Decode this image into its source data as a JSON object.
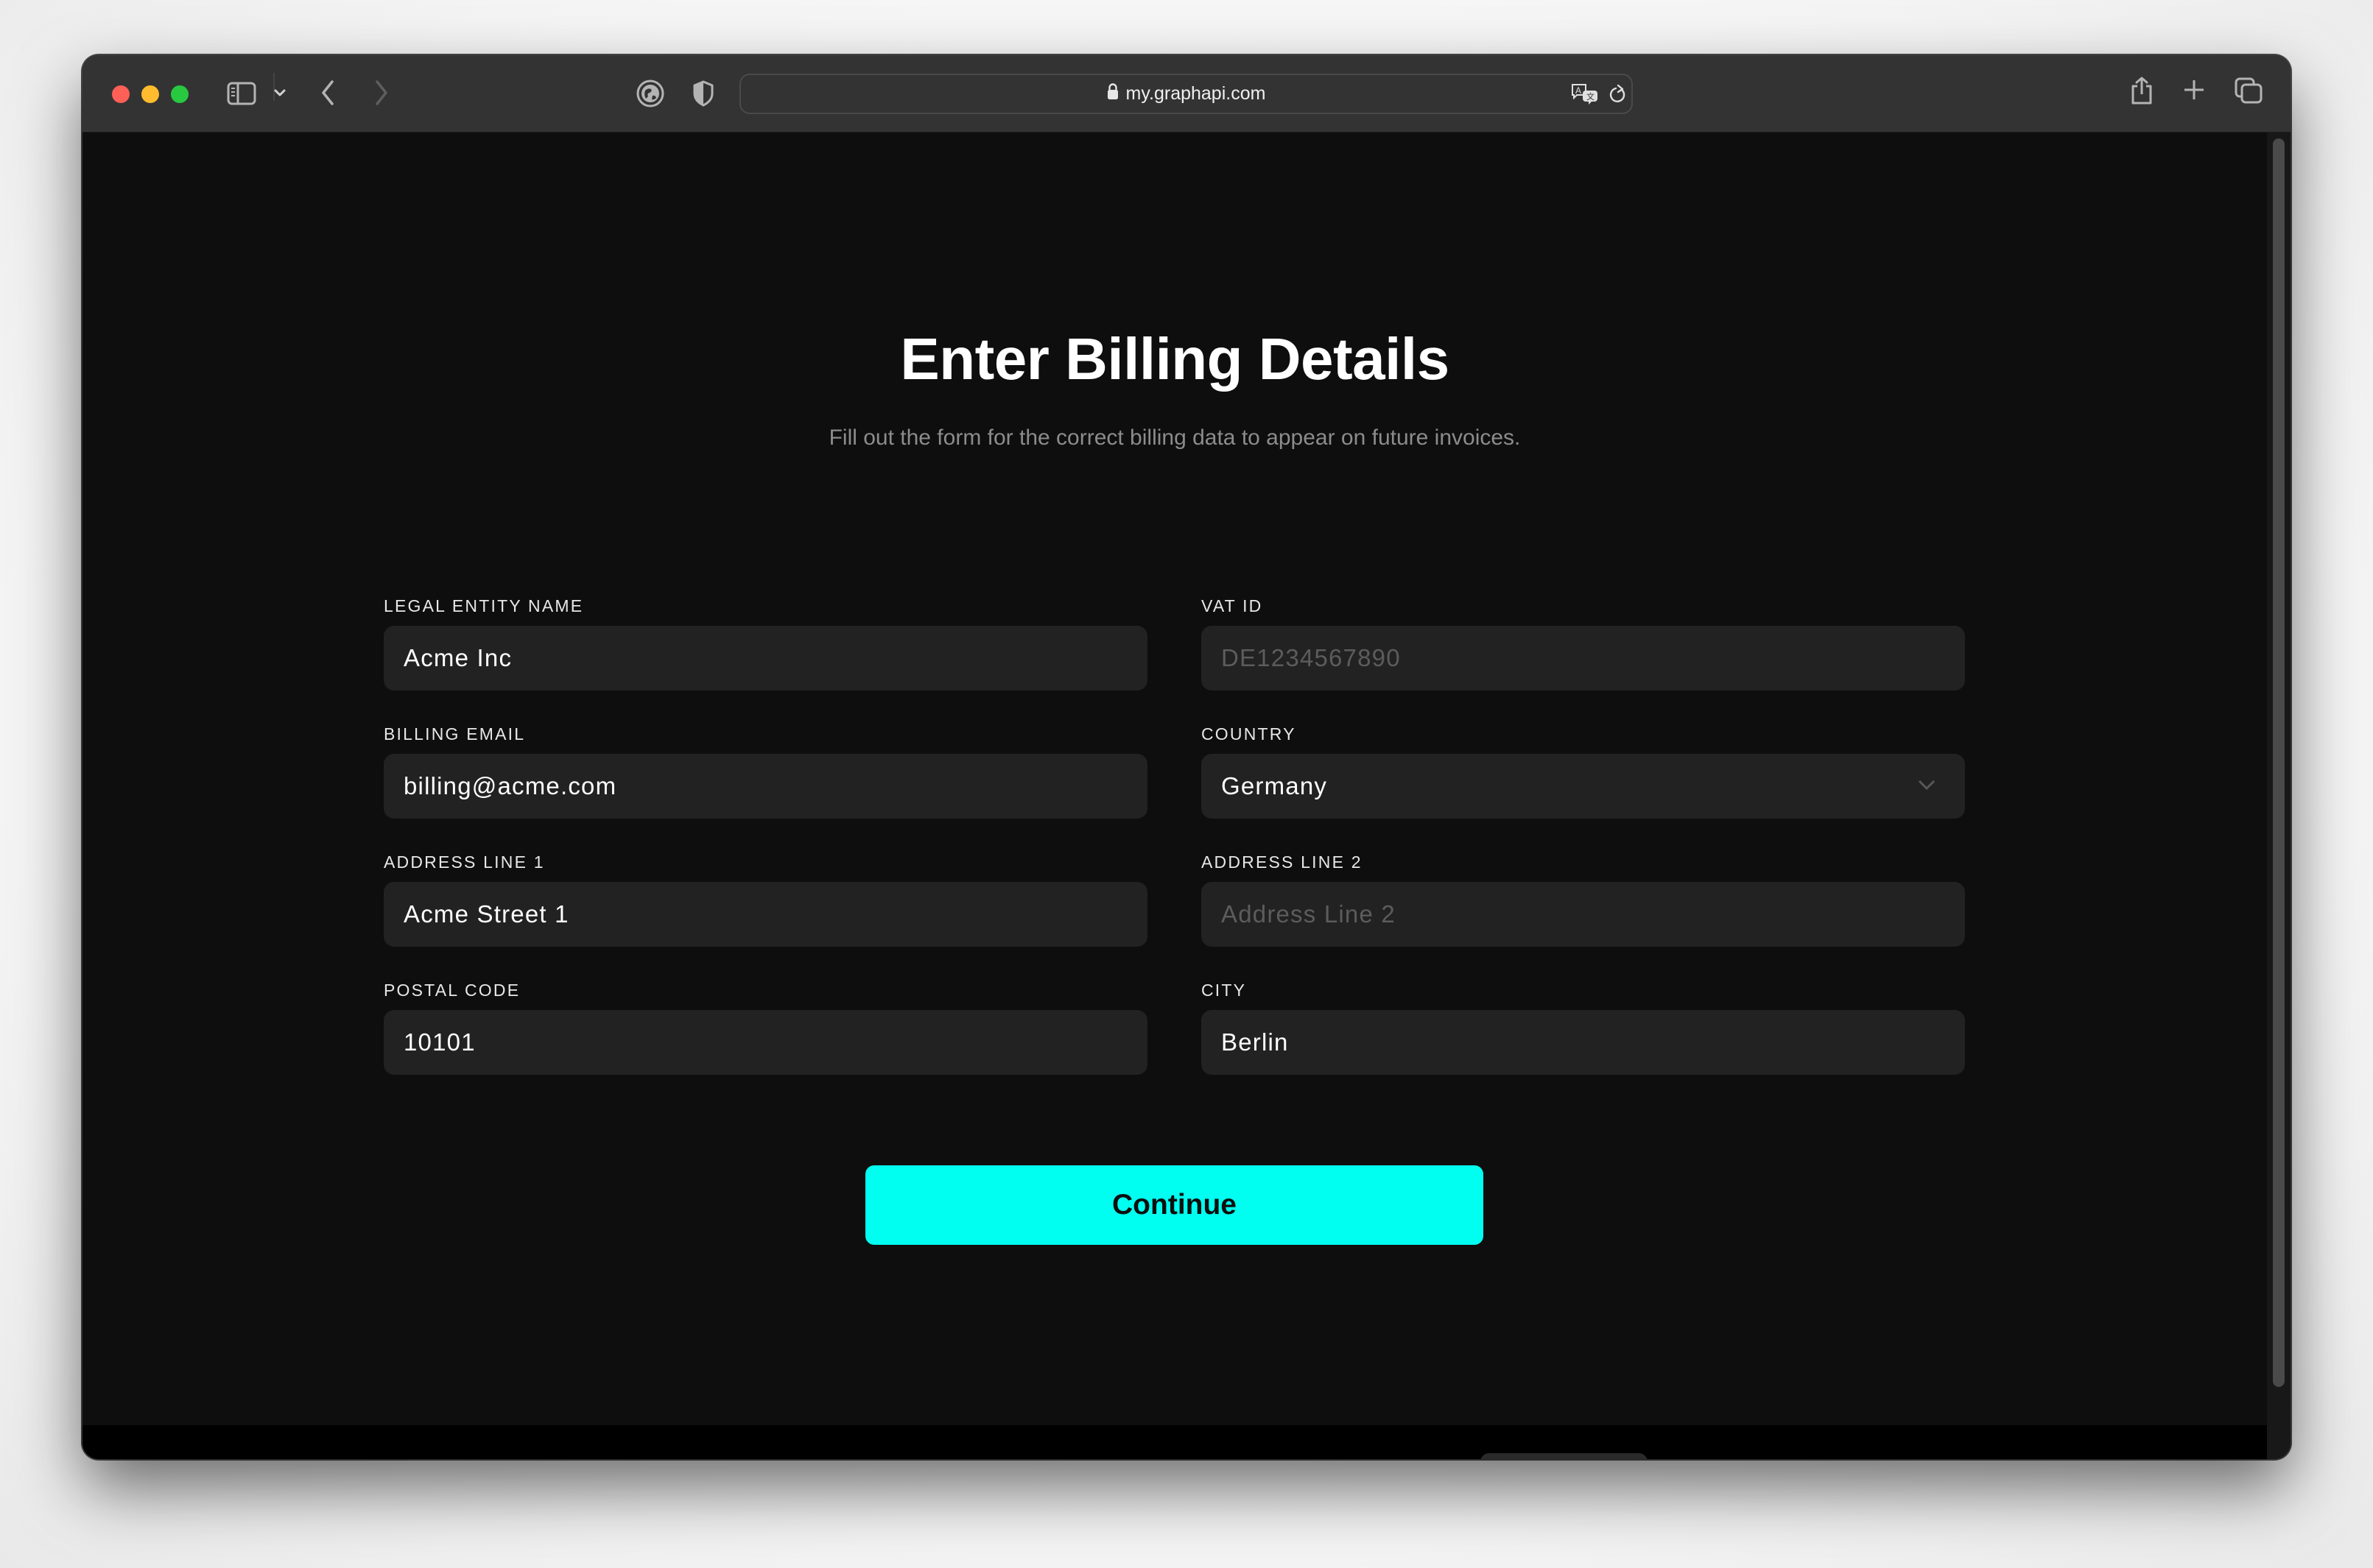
{
  "browser": {
    "url": "my.graphapi.com",
    "icons": {
      "traffic_lights": [
        "close",
        "minimize",
        "zoom"
      ],
      "left": [
        "sidebar-icon",
        "chevron-down-icon",
        "back-icon",
        "forward-icon",
        "globe-icon",
        "shield-icon"
      ],
      "address": [
        "lock-icon",
        "translate-icon",
        "reload-icon"
      ],
      "right": [
        "share-icon",
        "new-tab-icon",
        "tab-overview-icon"
      ]
    }
  },
  "page": {
    "title": "Enter Billing Details",
    "subtitle": "Fill out the form for the correct billing data to appear on future invoices."
  },
  "form": {
    "fields": [
      {
        "label": "LEGAL ENTITY NAME",
        "value": "Acme Inc",
        "placeholder": ""
      },
      {
        "label": "VAT ID",
        "value": "",
        "placeholder": "DE1234567890"
      },
      {
        "label": "BILLING EMAIL",
        "value": "billing@acme.com",
        "placeholder": ""
      },
      {
        "label": "COUNTRY",
        "value": "Germany",
        "type": "select"
      },
      {
        "label": "ADDRESS LINE 1",
        "value": "Acme Street 1",
        "placeholder": ""
      },
      {
        "label": "ADDRESS LINE 2",
        "value": "",
        "placeholder": "Address Line 2"
      },
      {
        "label": "POSTAL CODE",
        "value": "10101",
        "placeholder": ""
      },
      {
        "label": "CITY",
        "value": "Berlin",
        "placeholder": ""
      }
    ],
    "submit_label": "Continue"
  },
  "colors": {
    "accent": "#00fff0",
    "background": "#0e0e0e",
    "input_bg": "#222222",
    "placeholder": "#5c5c5c"
  }
}
